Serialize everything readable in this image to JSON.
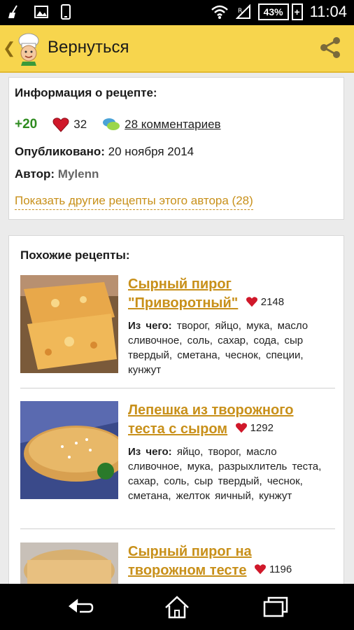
{
  "status_bar": {
    "battery": "43%",
    "time": "11:04"
  },
  "app_bar": {
    "title": "Вернуться"
  },
  "recipe_info": {
    "title": "Информация о рецепте:",
    "rating": "+20",
    "likes": "32",
    "comments": "28 комментариев",
    "published_label": "Опубликовано:",
    "published_value": "20 ноября 2014",
    "author_label": "Автор:",
    "author_name": "Mylenn",
    "more_link": "Показать другие рецепты этого автора (28)"
  },
  "similar": {
    "title": "Похожие рецепты:",
    "ingredients_label": "Из чего:",
    "items": [
      {
        "title": "Сырный пирог \"Приворотный\"",
        "likes": "2148",
        "ingredients": "творог, яйцо, мука, масло сливочное, соль, сахар, сода, сыр твердый, сметана, чеснок, специи, кунжут"
      },
      {
        "title": "Лепешка из творожного теста с сыром",
        "likes": "1292",
        "ingredients": "яйцо, творог, масло сливочное, мука, разрыхлитель теста, сахар, соль, сыр твердый, чеснок, сметана, желток яичный, кунжут"
      },
      {
        "title": "Сырный пирог на творожном тесте",
        "likes": "1196",
        "ingredients": ""
      }
    ]
  },
  "colors": {
    "appbar": "#f7d54d",
    "link": "#c8901a",
    "rating": "#2e8b1f",
    "heart": "#d0182a"
  },
  "icons": {
    "back": "chevron-left-icon",
    "logo": "chef-logo-icon",
    "share": "share-icon",
    "heart": "heart-icon",
    "comments": "comments-icon",
    "nav": [
      "back-icon",
      "home-icon",
      "recent-apps-icon"
    ]
  }
}
